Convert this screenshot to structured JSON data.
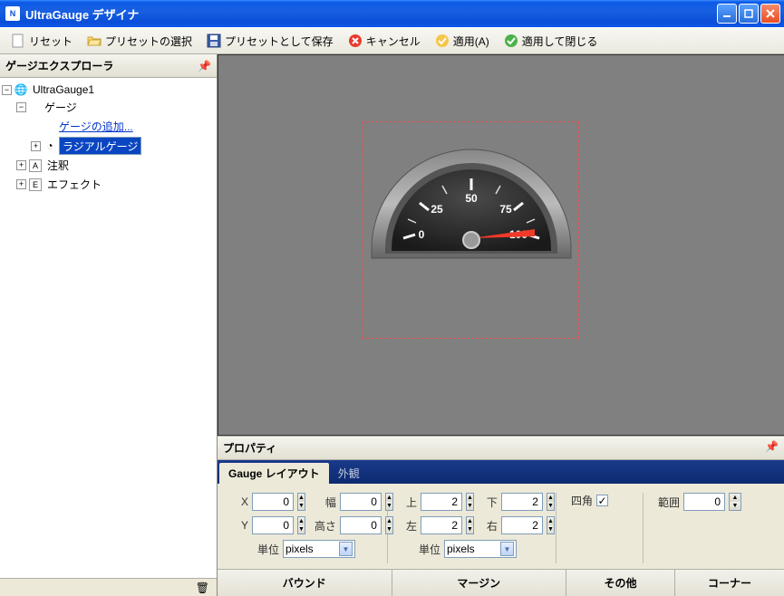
{
  "title": "UltraGauge デザイナ",
  "toolbar": {
    "reset": "リセット",
    "load_preset": "プリセットの選択",
    "save_preset": "プリセットとして保存",
    "cancel": "キャンセル",
    "apply": "適用(A)",
    "apply_close": "適用して閉じる"
  },
  "explorer": {
    "header": "ゲージエクスプローラ",
    "root": "UltraGauge1",
    "node_gauge": "ゲージ",
    "add_gauge": "ゲージの追加...",
    "radial_gauge": "ラジアルゲージ",
    "annotations": "注釈",
    "effects": "エフェクト"
  },
  "gauge": {
    "labels": [
      "0",
      "25",
      "50",
      "75",
      "100"
    ],
    "value": 90
  },
  "props": {
    "header": "プロパティ",
    "tabs": {
      "layout": "Gauge レイアウト",
      "appearance": "外観"
    },
    "x_label": "X",
    "x": "0",
    "y_label": "Y",
    "y": "0",
    "width_label": "幅",
    "width": "0",
    "height_label": "高さ",
    "height": "0",
    "unit_label": "単位",
    "unit_value": "pixels",
    "top_label": "上",
    "top": "2",
    "bottom_label": "下",
    "bottom": "2",
    "left_label": "左",
    "left": "2",
    "right_label": "右",
    "right": "2",
    "margin_unit_label": "単位",
    "margin_unit_value": "pixels",
    "square_label": "四角",
    "square_checked": "✓",
    "extent_label": "範囲",
    "extent": "0",
    "footer": {
      "bounds": "バウンド",
      "margin": "マージン",
      "misc": "その他",
      "corner": "コーナー"
    }
  }
}
